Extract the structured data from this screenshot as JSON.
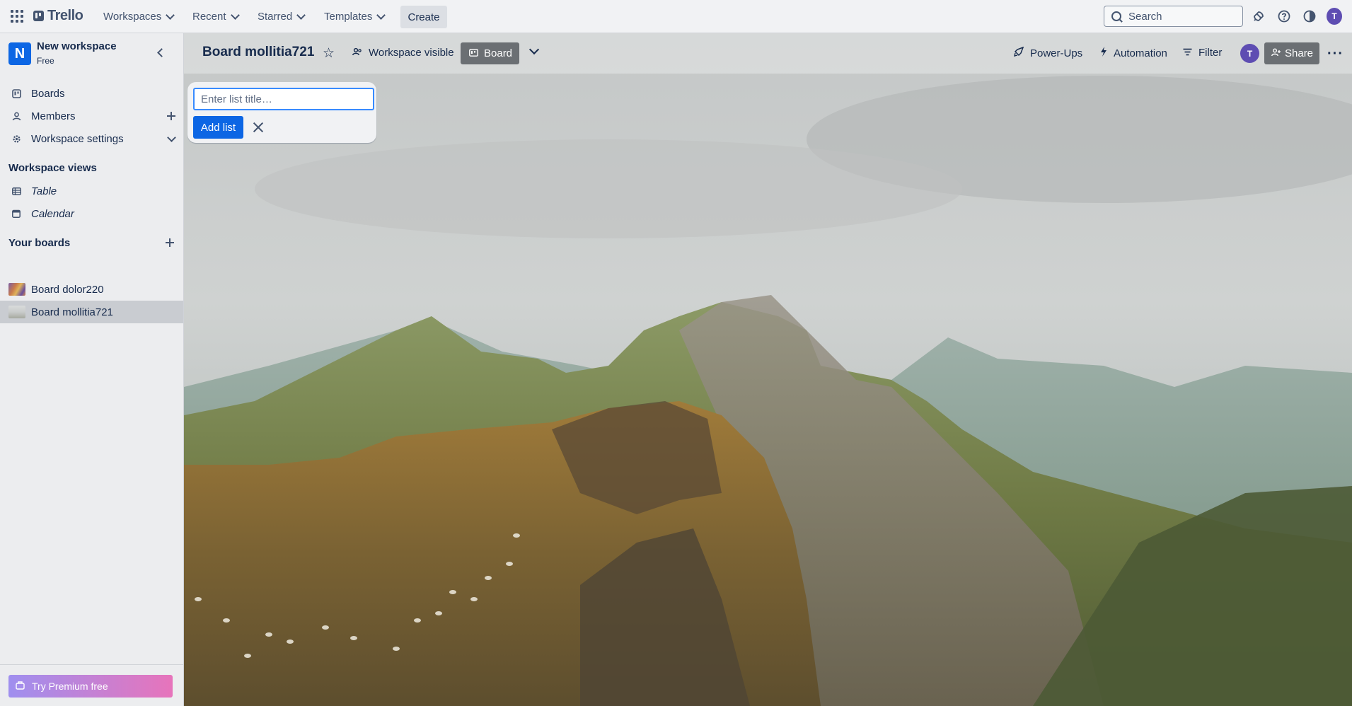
{
  "header": {
    "logo": "Trello",
    "nav": [
      {
        "label": "Workspaces"
      },
      {
        "label": "Recent"
      },
      {
        "label": "Starred"
      },
      {
        "label": "Templates"
      }
    ],
    "create_label": "Create",
    "search_placeholder": "Search",
    "avatar_initial": "T",
    "icons": [
      "apps-grid-icon",
      "notification-bell-icon",
      "help-icon",
      "theme-toggle-icon"
    ]
  },
  "sidebar": {
    "workspace_initial": "N",
    "workspace_name": "New workspace",
    "workspace_plan": "Free",
    "items": [
      {
        "label": "Boards",
        "icon": "board-icon"
      },
      {
        "label": "Members",
        "icon": "person-icon"
      },
      {
        "label": "Workspace settings",
        "icon": "gear-icon"
      }
    ],
    "views_heading": "Workspace views",
    "views": [
      {
        "label": "Table",
        "icon": "table-icon"
      },
      {
        "label": "Calendar",
        "icon": "calendar-icon"
      }
    ],
    "boards_heading": "Your boards",
    "boards": [
      {
        "label": "Board dolor220",
        "active": false
      },
      {
        "label": "Board mollitia721",
        "active": true
      }
    ],
    "premium_label": "Try Premium free"
  },
  "board": {
    "title": "Board mollitia721",
    "visibility_label": "Workspace visible",
    "view_label": "Board",
    "powerups_label": "Power-Ups",
    "automation_label": "Automation",
    "filter_label": "Filter",
    "member_initial": "T",
    "share_label": "Share",
    "add_list": {
      "placeholder": "Enter list title…",
      "value": "",
      "button_label": "Add list"
    }
  },
  "colors": {
    "primary": "#0c66e4",
    "avatar": "#5e4db2",
    "sidebar_bg": "#ecedef"
  }
}
